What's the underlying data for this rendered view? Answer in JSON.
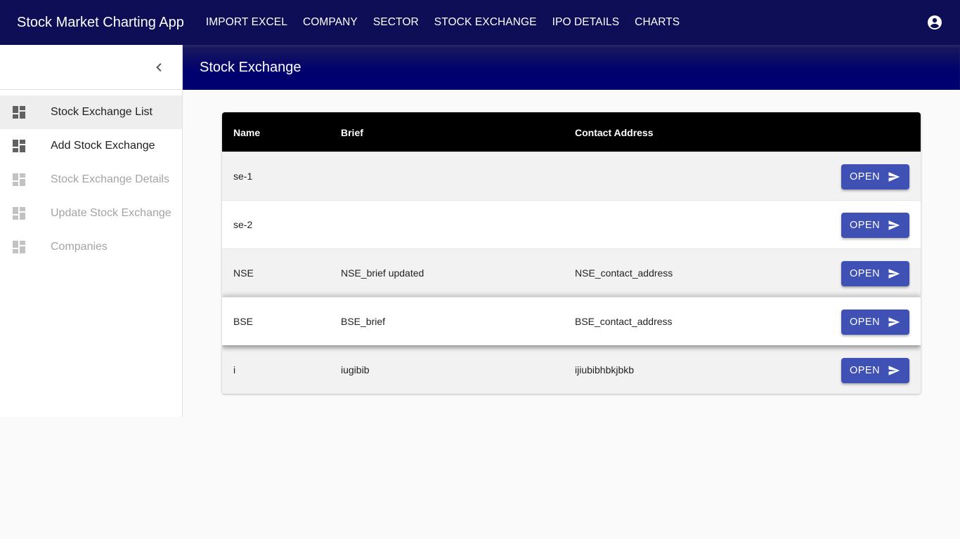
{
  "app": {
    "title": "Stock Market Charting App",
    "nav": [
      "IMPORT EXCEL",
      "COMPANY",
      "SECTOR",
      "STOCK EXCHANGE",
      "IPO DETAILS",
      "CHARTS"
    ],
    "account_icon": "account-circle-icon"
  },
  "sidebar": {
    "collapse_icon": "chevron-left-icon",
    "items": [
      {
        "label": "Stock Exchange List",
        "icon": "dashboard-icon",
        "state": "active"
      },
      {
        "label": "Add Stock Exchange",
        "icon": "dashboard-icon",
        "state": "enabled"
      },
      {
        "label": "Stock Exchange Details",
        "icon": "dashboard-icon",
        "state": "disabled"
      },
      {
        "label": "Update Stock Exchange",
        "icon": "dashboard-icon",
        "state": "disabled"
      },
      {
        "label": "Companies",
        "icon": "dashboard-icon",
        "state": "disabled"
      }
    ]
  },
  "page": {
    "title": "Stock Exchange"
  },
  "table": {
    "columns": [
      "Name",
      "Brief",
      "Contact Address"
    ],
    "rows": [
      {
        "name": "se-1",
        "brief": "",
        "address": "",
        "action": "OPEN"
      },
      {
        "name": "se-2",
        "brief": "",
        "address": "",
        "action": "OPEN"
      },
      {
        "name": "NSE",
        "brief": "NSE_brief updated",
        "address": "NSE_contact_address",
        "action": "OPEN"
      },
      {
        "name": "BSE",
        "brief": "BSE_brief",
        "address": "BSE_contact_address",
        "action": "OPEN"
      },
      {
        "name": "i",
        "brief": "iugibib",
        "address": "ijiubibhbkjbkb",
        "action": "OPEN"
      }
    ],
    "action_icon": "send-icon"
  },
  "colors": {
    "toolbar": "#0e0e56",
    "header": "#000070",
    "button": "#3f51b5",
    "table_header": "#000000"
  }
}
